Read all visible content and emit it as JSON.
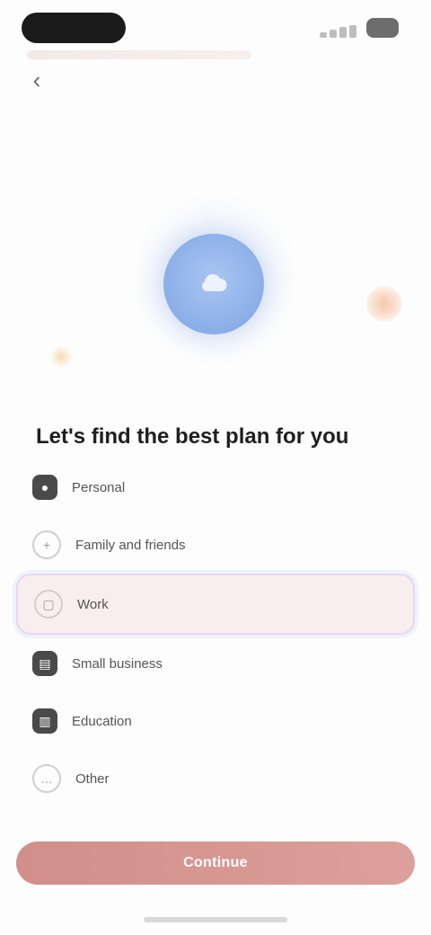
{
  "status": {
    "time": ""
  },
  "nav": {
    "back_icon": "back-arrow-icon"
  },
  "hero": {
    "icon": "cloud-icon"
  },
  "headline": "Let's find the best plan for you",
  "options": [
    {
      "label": "Personal",
      "icon": "user-icon"
    },
    {
      "label": "Family and friends",
      "icon": "users-icon"
    },
    {
      "label": "Work",
      "icon": "briefcase-icon",
      "selected": true
    },
    {
      "label": "Small business",
      "icon": "store-icon"
    },
    {
      "label": "Education",
      "icon": "book-icon"
    },
    {
      "label": "Other",
      "icon": "more-icon"
    }
  ],
  "cta": {
    "label": "Continue"
  },
  "colors": {
    "accent": "#d18e8a",
    "hero_blue": "#8fb1e9",
    "selected_bg": "#f8eeee"
  }
}
